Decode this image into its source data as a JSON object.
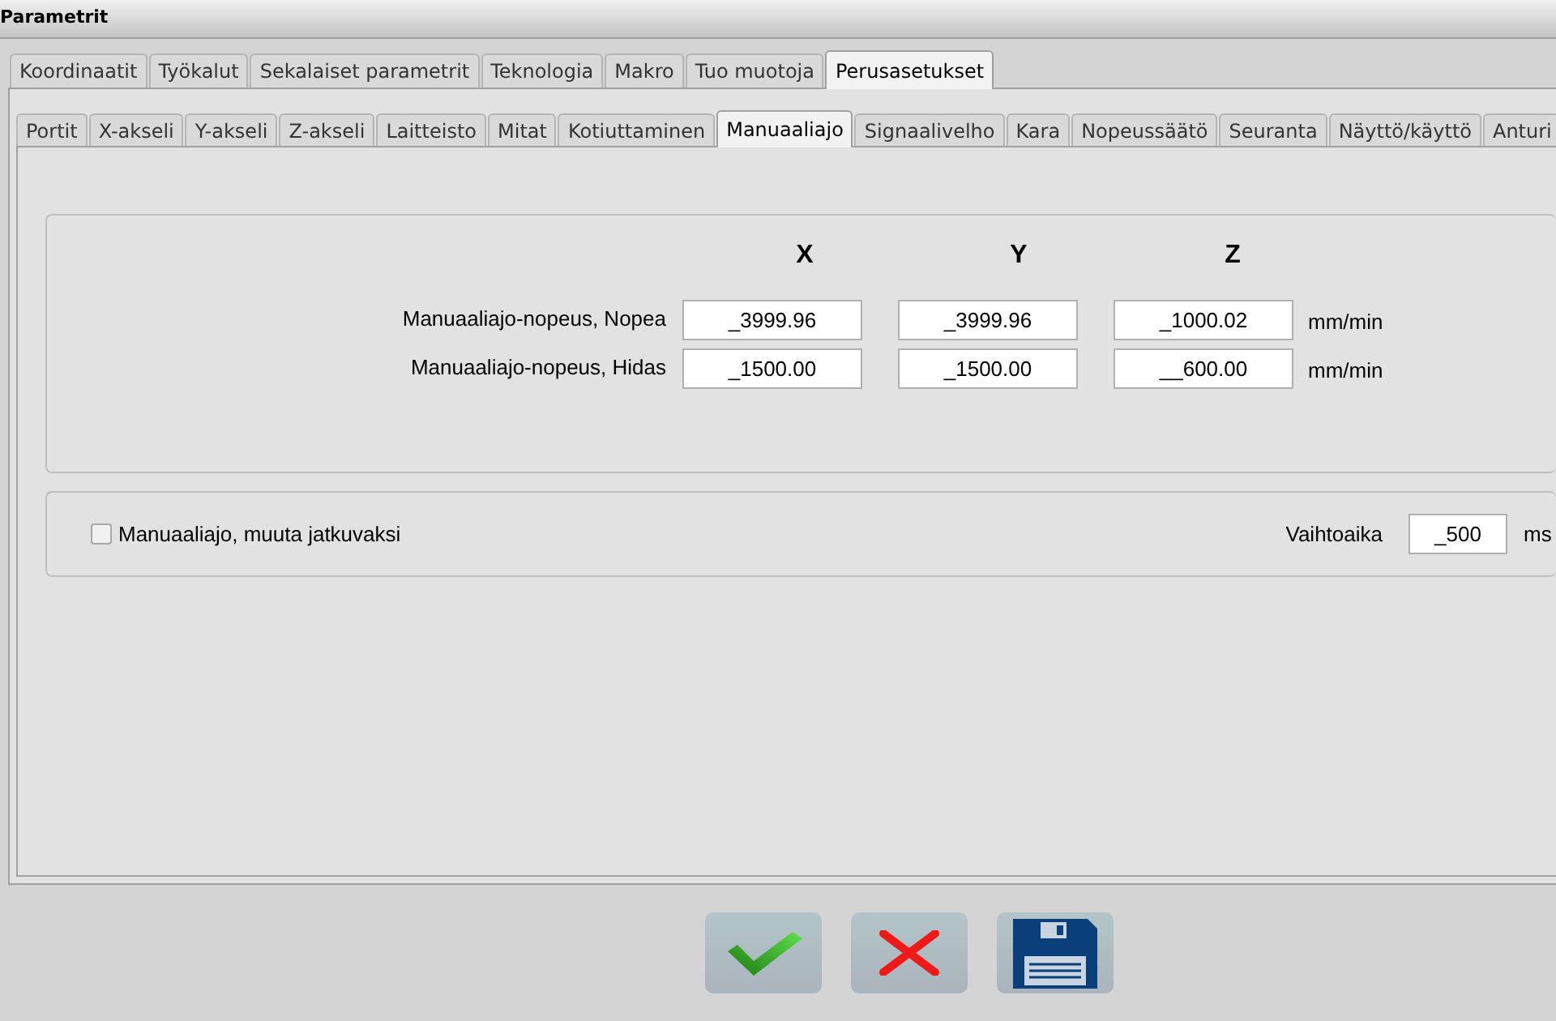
{
  "window": {
    "title": "Parametrit"
  },
  "tabs": [
    {
      "label": "Koordinaatit",
      "selected": false
    },
    {
      "label": "Työkalut",
      "selected": false
    },
    {
      "label": "Sekalaiset parametrit",
      "selected": false
    },
    {
      "label": "Teknologia",
      "selected": false
    },
    {
      "label": "Makro",
      "selected": false
    },
    {
      "label": "Tuo muotoja",
      "selected": false
    },
    {
      "label": "Perusasetukset",
      "selected": true
    }
  ],
  "subtabs": [
    {
      "label": "Portit",
      "selected": false
    },
    {
      "label": "X-akseli",
      "selected": false
    },
    {
      "label": "Y-akseli",
      "selected": false
    },
    {
      "label": "Z-akseli",
      "selected": false
    },
    {
      "label": "Laitteisto",
      "selected": false
    },
    {
      "label": "Mitat",
      "selected": false
    },
    {
      "label": "Kotiuttaminen",
      "selected": false
    },
    {
      "label": "Manuaaliajo",
      "selected": true
    },
    {
      "label": "Signaalivelho",
      "selected": false
    },
    {
      "label": "Kara",
      "selected": false
    },
    {
      "label": "Nopeussäätö",
      "selected": false
    },
    {
      "label": "Seuranta",
      "selected": false
    },
    {
      "label": "Näyttö/käyttö",
      "selected": false
    },
    {
      "label": "Anturi",
      "selected": false
    }
  ],
  "speeds": {
    "columns": [
      "X",
      "Y",
      "Z"
    ],
    "rows": [
      {
        "label": "Manuaaliajo-nopeus, Nopea",
        "values": [
          "_3999.96",
          "_3999.96",
          "_1000.02"
        ],
        "unit": "mm/min"
      },
      {
        "label": "Manuaaliajo-nopeus, Hidas",
        "values": [
          "_1500.00",
          "_1500.00",
          "__600.00"
        ],
        "unit": "mm/min"
      }
    ]
  },
  "continuous": {
    "label": "Manuaaliajo, muuta jatkuvaksi",
    "checked": false
  },
  "switch_time": {
    "label": "Vaihtoaika",
    "value": "_500",
    "unit": "ms"
  },
  "buttons": [
    {
      "kind": "ok"
    },
    {
      "kind": "cancel"
    },
    {
      "kind": "save"
    }
  ]
}
